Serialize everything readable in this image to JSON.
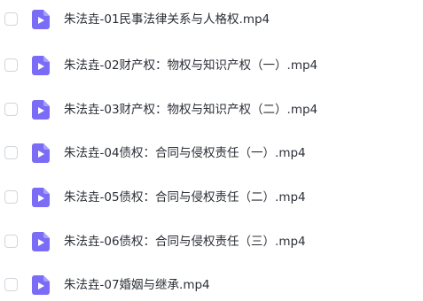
{
  "icons": {
    "checkbox": "checkbox-unchecked",
    "file": "video-file-icon"
  },
  "colors": {
    "file_icon": "#7b6cf6",
    "file_icon_play": "#ffffff",
    "text": "#2b2f36",
    "checkbox_border": "#d2d5db"
  },
  "files": [
    {
      "name": "朱法垚-01民事法律关系与人格权.mp4"
    },
    {
      "name": "朱法垚-02财产权：物权与知识产权（一）.mp4"
    },
    {
      "name": "朱法垚-03财产权：物权与知识产权（二）.mp4"
    },
    {
      "name": "朱法垚-04债权：合同与侵权责任（一）.mp4"
    },
    {
      "name": "朱法垚-05债权：合同与侵权责任（二）.mp4"
    },
    {
      "name": "朱法垚-06债权：合同与侵权责任（三）.mp4"
    },
    {
      "name": "朱法垚-07婚姻与继承.mp4"
    }
  ]
}
